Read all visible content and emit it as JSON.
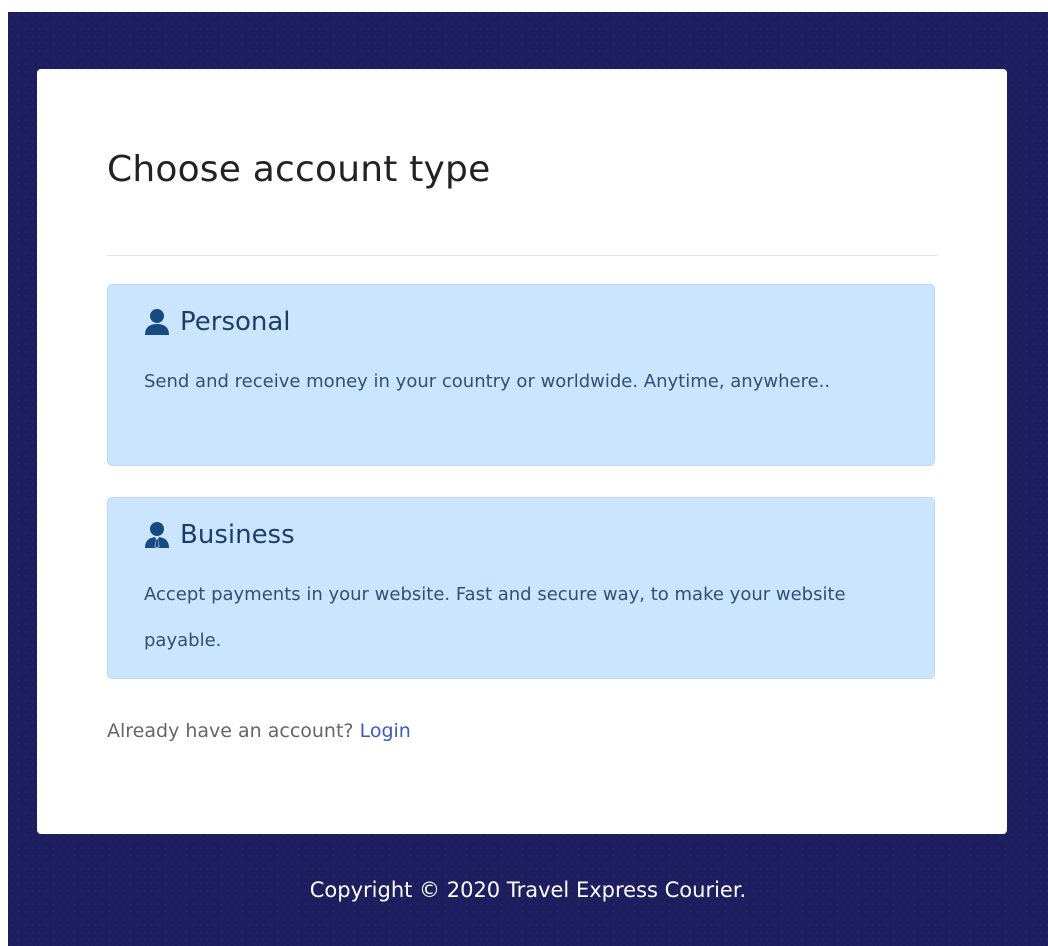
{
  "page": {
    "title": "Choose account type"
  },
  "options": [
    {
      "id": "personal",
      "label": "Personal",
      "icon": "user-icon",
      "description": "Send and receive money in your country or worldwide. Anytime, anywhere.."
    },
    {
      "id": "business",
      "label": "Business",
      "icon": "business-user-icon",
      "description": "Accept payments in your website. Fast and secure way, to make your website payable."
    }
  ],
  "login": {
    "prompt": "Already have an account?",
    "link_label": "Login"
  },
  "footer": {
    "copyright": "Copyright © 2020 Travel Express Courier."
  },
  "colors": {
    "background": "#1d1e5f",
    "card": "#ffffff",
    "option_bg": "#cce5fe",
    "option_text": "#1d3d6b",
    "link": "#3e59c4"
  }
}
